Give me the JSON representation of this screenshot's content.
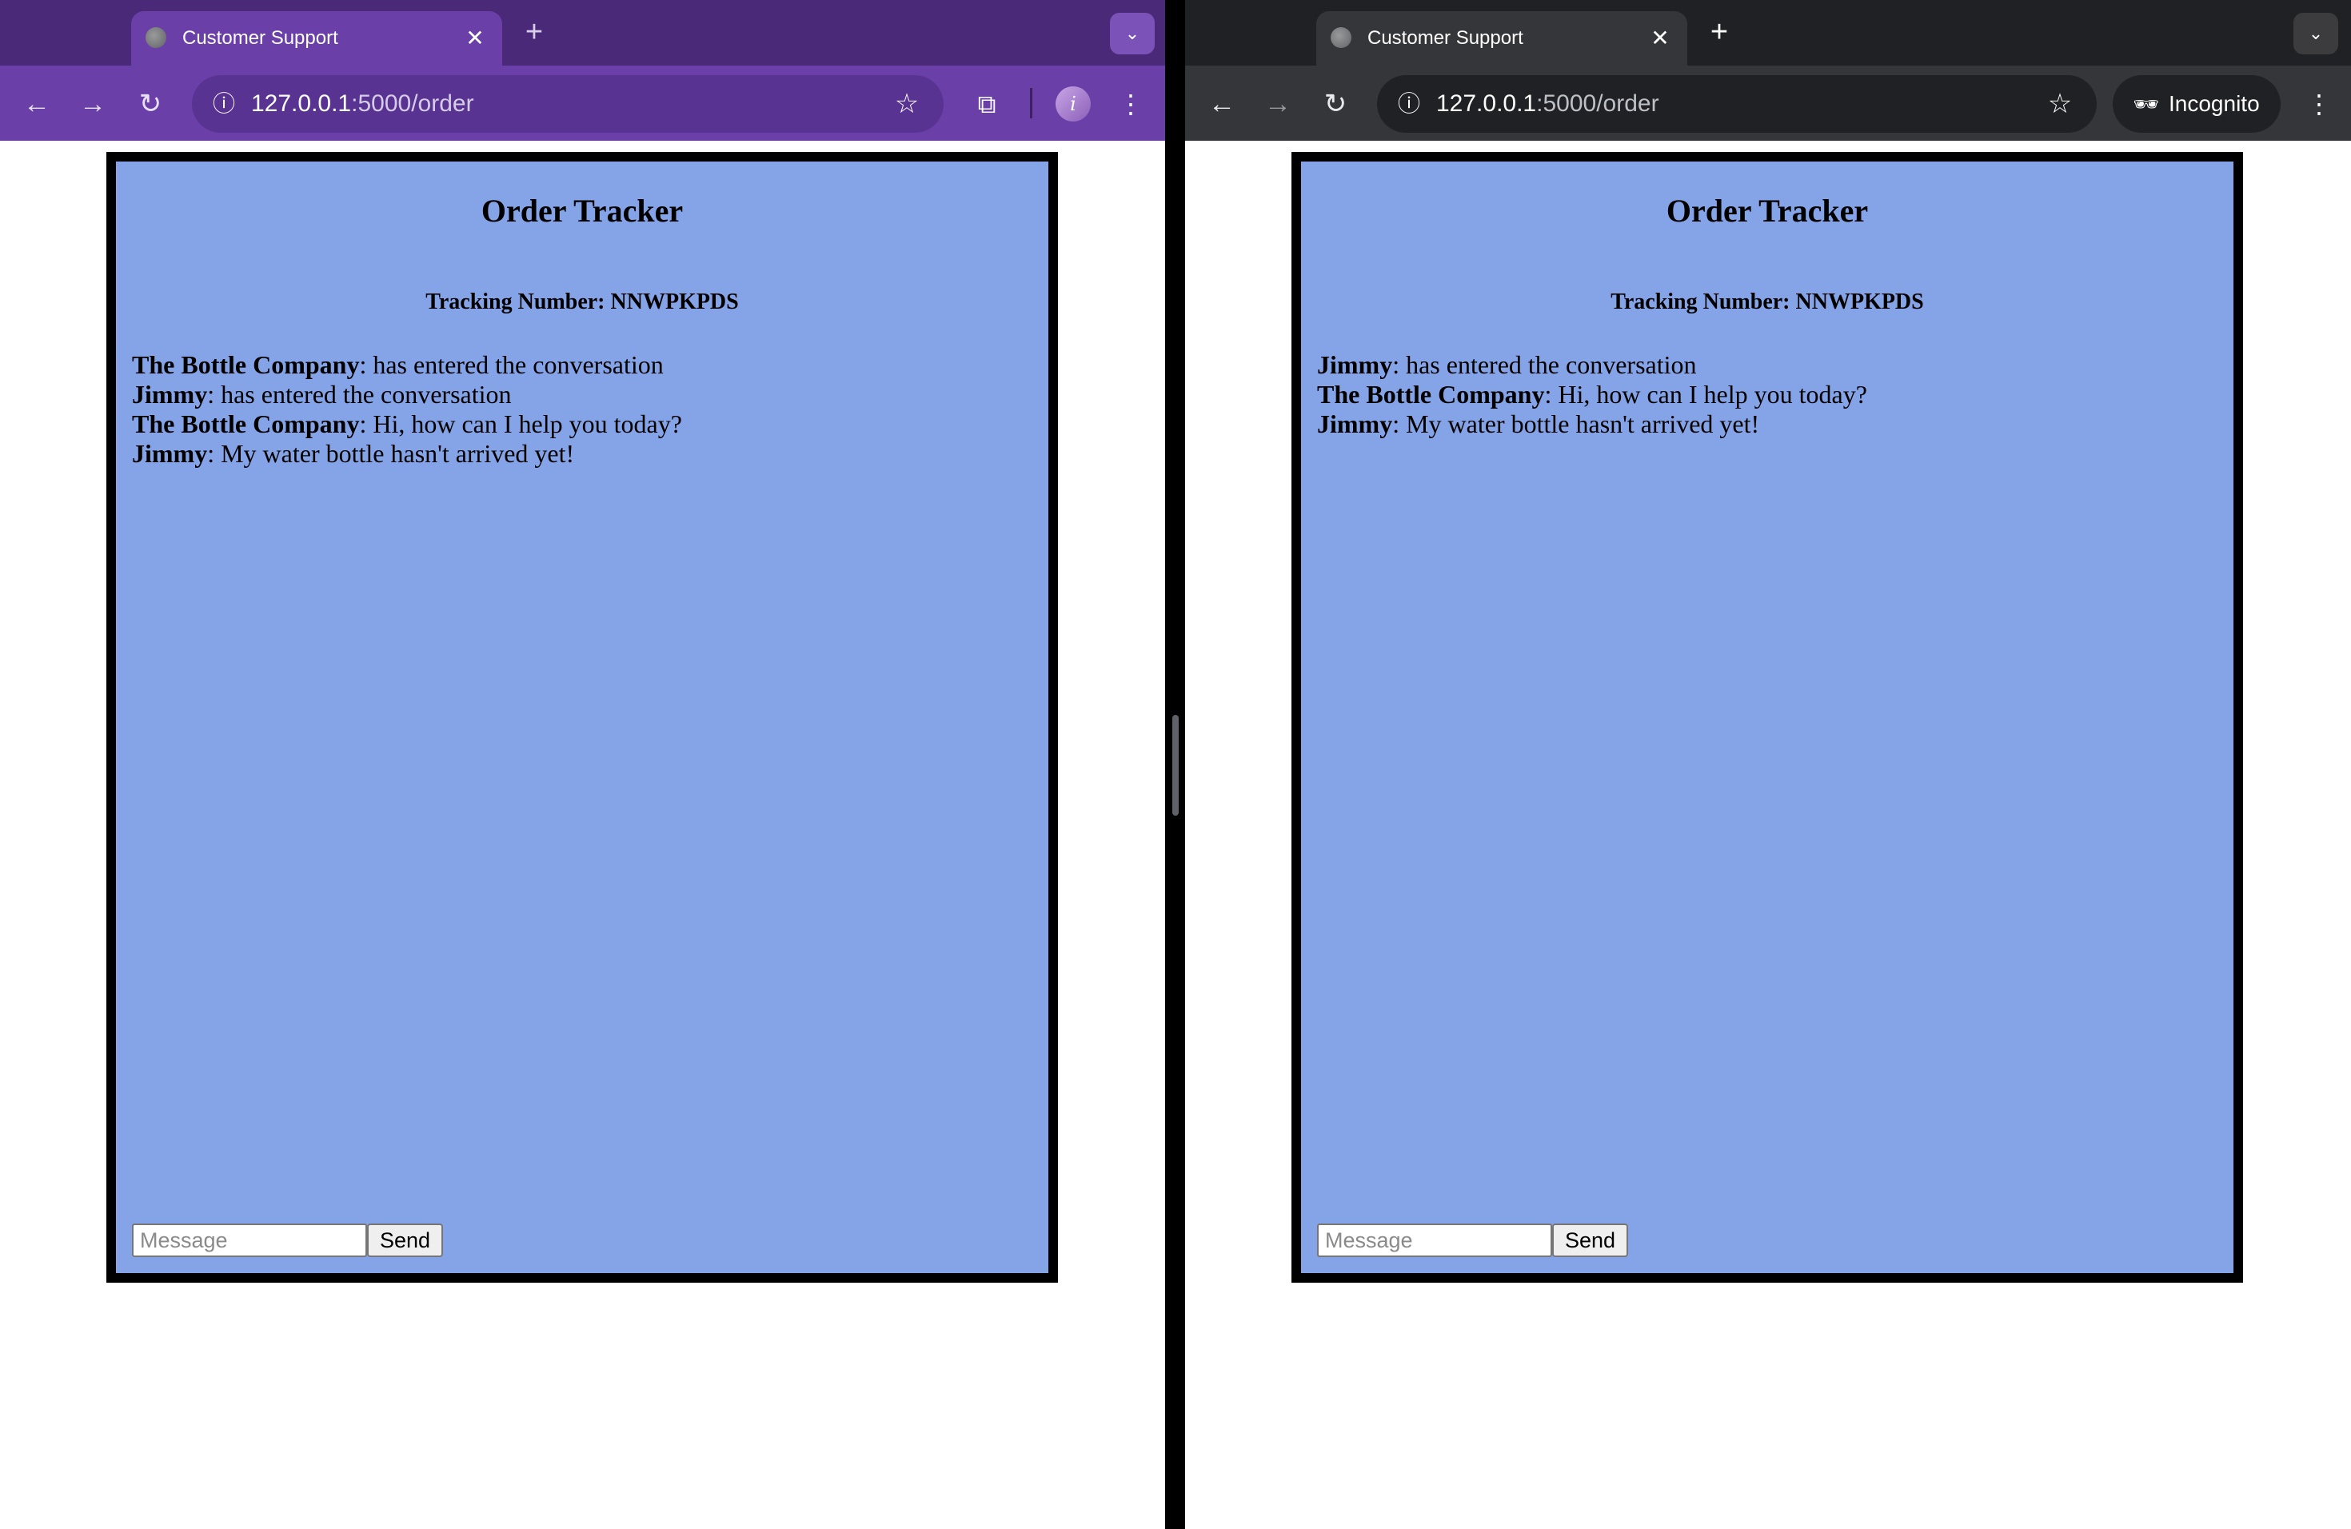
{
  "left_window": {
    "tab": {
      "title": "Customer Support"
    },
    "url": {
      "host": "127.0.0.1",
      "path": ":5000/order"
    },
    "theme_color": "#6b3fa8",
    "profile_initial": "i"
  },
  "right_window": {
    "tab": {
      "title": "Customer Support"
    },
    "url": {
      "host": "127.0.0.1",
      "path": ":5000/order"
    },
    "incognito_label": "Incognito"
  },
  "page": {
    "title": "Order Tracker",
    "tracking_label": "Tracking Number:",
    "tracking_number": "NNWPKPDS",
    "message_placeholder": "Message",
    "send_label": "Send",
    "background_color": "#85a3e7"
  },
  "left_chat": [
    {
      "sender": "The Bottle Company",
      "text": ": has entered the conversation"
    },
    {
      "sender": "Jimmy",
      "text": ": has entered the conversation"
    },
    {
      "sender": "The Bottle Company",
      "text": ": Hi, how can I help you today?"
    },
    {
      "sender": "Jimmy",
      "text": ": My water bottle hasn't arrived yet!"
    }
  ],
  "right_chat": [
    {
      "sender": "Jimmy",
      "text": ": has entered the conversation"
    },
    {
      "sender": "The Bottle Company",
      "text": ": Hi, how can I help you today?"
    },
    {
      "sender": "Jimmy",
      "text": ": My water bottle hasn't arrived yet!"
    }
  ],
  "icons": [
    "globe-icon",
    "close-icon",
    "plus-icon",
    "chevron-down-icon",
    "back-arrow-icon",
    "forward-arrow-icon",
    "reload-icon",
    "info-icon",
    "star-icon",
    "extensions-icon",
    "kebab-menu-icon",
    "incognito-icon"
  ]
}
